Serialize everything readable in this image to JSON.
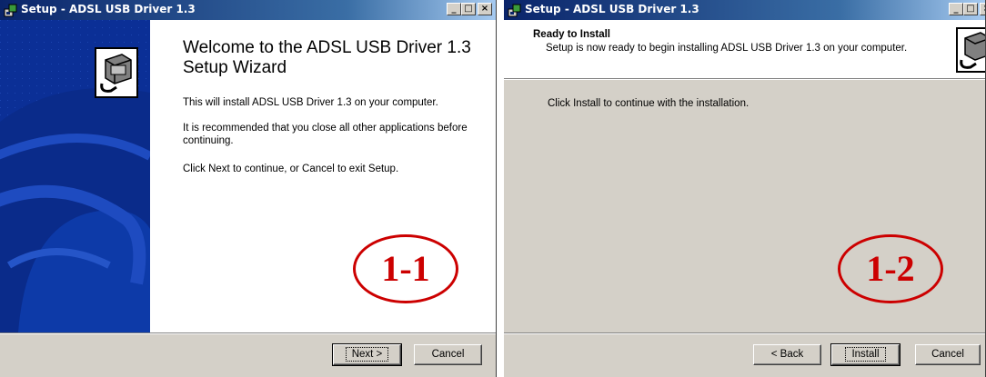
{
  "window1": {
    "title": "Setup - ADSL USB Driver 1.3",
    "welcome_title": "Welcome to the ADSL USB Driver 1.3 Setup Wizard",
    "paragraphs": [
      "This will install ADSL USB Driver 1.3 on your computer.",
      "It is recommended that you close all other applications before continuing.",
      "Click Next to continue, or Cancel to exit Setup."
    ],
    "next_label": "Next >",
    "cancel_label": "Cancel",
    "annotation": "1-1"
  },
  "window2": {
    "title": "Setup - ADSL USB Driver 1.3",
    "header_title": "Ready to Install",
    "header_subtitle": "Setup is now ready to begin installing ADSL USB Driver 1.3 on your computer.",
    "body_text": "Click Install to continue with the installation.",
    "back_label": "< Back",
    "install_label": "Install",
    "cancel_label": "Cancel",
    "annotation": "1-2"
  },
  "titlebar_buttons": {
    "minimize": "_",
    "maximize": "□",
    "close": "×"
  },
  "icons": [
    "setup-app-icon",
    "usb-installer-icon"
  ],
  "colors": {
    "titlebar": "#0a246a",
    "banner": "#0b2f96",
    "face": "#d4d0c8",
    "annotation": "#cc0000"
  }
}
